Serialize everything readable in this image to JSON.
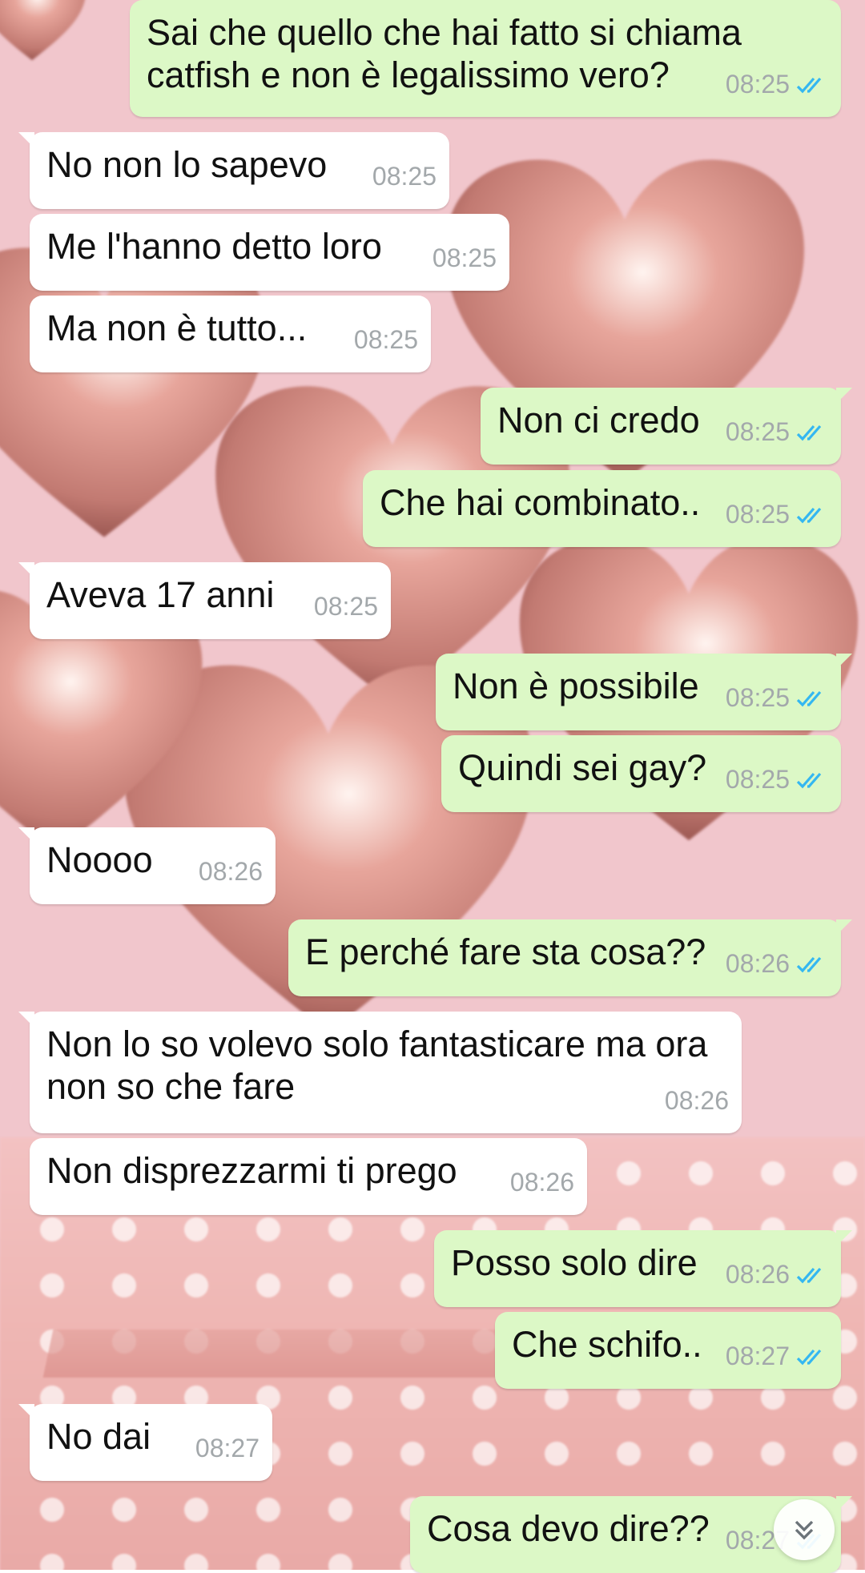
{
  "chat": {
    "messages": [
      {
        "direction": "out",
        "lines": [
          "Sai che quello che hai fatto si chiama",
          "catfish e non è legalissimo vero?"
        ],
        "time": "08:25",
        "read": true
      },
      {
        "direction": "in",
        "lines": [
          "No non lo sapevo"
        ],
        "time": "08:25"
      },
      {
        "direction": "in",
        "lines": [
          "Me l'hanno detto loro"
        ],
        "time": "08:25"
      },
      {
        "direction": "in",
        "lines": [
          "Ma non è tutto..."
        ],
        "time": "08:25"
      },
      {
        "direction": "out",
        "lines": [
          "Non ci credo"
        ],
        "time": "08:25",
        "read": true
      },
      {
        "direction": "out",
        "lines": [
          "Che hai combinato.."
        ],
        "time": "08:25",
        "read": true
      },
      {
        "direction": "in",
        "lines": [
          "Aveva 17 anni"
        ],
        "time": "08:25"
      },
      {
        "direction": "out",
        "lines": [
          "Non è possibile"
        ],
        "time": "08:25",
        "read": true
      },
      {
        "direction": "out",
        "lines": [
          "Quindi sei gay?"
        ],
        "time": "08:25",
        "read": true
      },
      {
        "direction": "in",
        "lines": [
          "Noooo"
        ],
        "time": "08:26"
      },
      {
        "direction": "out",
        "lines": [
          "E perché fare sta cosa??"
        ],
        "time": "08:26",
        "read": true
      },
      {
        "direction": "in",
        "lines": [
          "Non lo so volevo solo fantasticare ma ora",
          "non so che fare"
        ],
        "time": "08:26"
      },
      {
        "direction": "in",
        "lines": [
          "Non disprezzarmi ti prego"
        ],
        "time": "08:26"
      },
      {
        "direction": "out",
        "lines": [
          "Posso solo dire"
        ],
        "time": "08:26",
        "read": true
      },
      {
        "direction": "out",
        "lines": [
          "Che schifo.."
        ],
        "time": "08:27",
        "read": true
      },
      {
        "direction": "in",
        "lines": [
          "No dai"
        ],
        "time": "08:27"
      },
      {
        "direction": "out",
        "lines": [
          "Cosa devo dire??"
        ],
        "time": "08:27",
        "read": true
      }
    ]
  },
  "icons": {
    "read_receipt": "double-check-icon",
    "scroll_down": "double-chevron-down-icon"
  },
  "colors": {
    "incoming_bubble": "#ffffff",
    "outgoing_bubble": "#dcf8c6",
    "read_tick": "#34b7f1",
    "timestamp": "#a3a8ab",
    "wallpaper": "#f1c6cc"
  }
}
